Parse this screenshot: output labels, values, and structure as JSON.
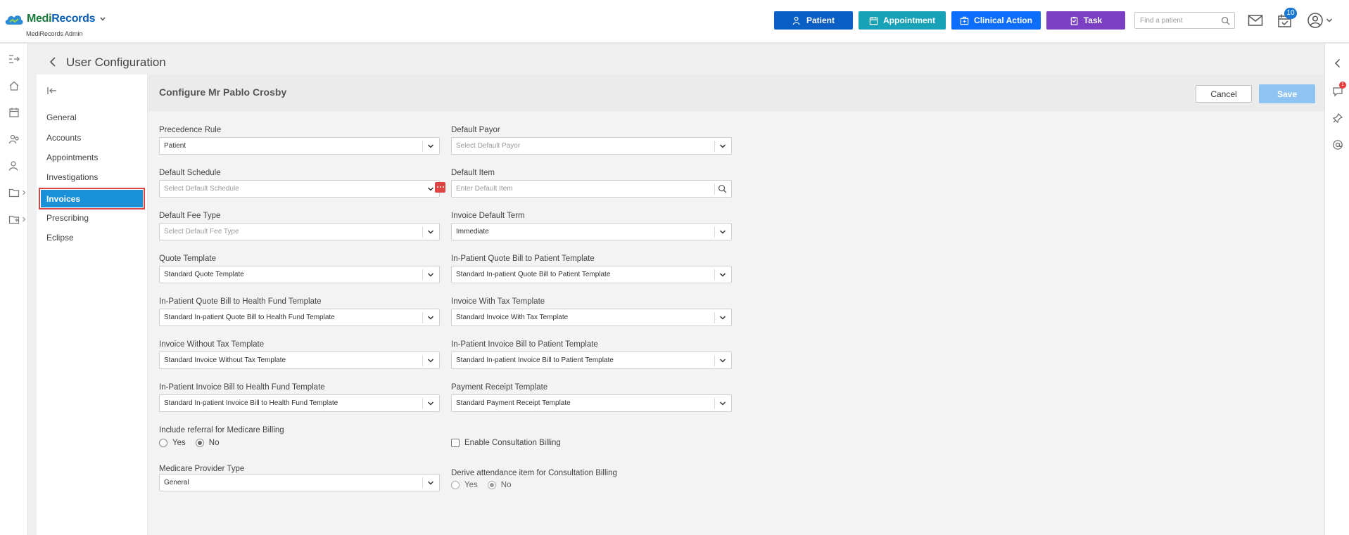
{
  "app": {
    "logo_text_a": "Medi",
    "logo_text_b": "Records",
    "subtitle": "MediRecords Admin"
  },
  "header": {
    "patient_label": "Patient",
    "appointment_label": "Appointment",
    "clinical_action_label": "Clinical Action",
    "task_label": "Task",
    "search_placeholder": "Find a patient",
    "tasks_count": "10",
    "colors": {
      "patient": "#0b5fc4",
      "appointment": "#17a2b8",
      "clinical_action": "#0d6efd",
      "task": "#7b3fc4"
    }
  },
  "notifications_count": "1",
  "page": {
    "title": "User Configuration"
  },
  "subnav": {
    "items": [
      "General",
      "Accounts",
      "Appointments",
      "Investigations",
      "Invoices",
      "Prescribing",
      "Eclipse"
    ],
    "active": "Invoices"
  },
  "content": {
    "title": "Configure Mr Pablo Crosby",
    "cancel_label": "Cancel",
    "save_label": "Save",
    "fields": {
      "precedence_rule": {
        "label": "Precedence Rule",
        "value": "Patient"
      },
      "default_payor": {
        "label": "Default Payor",
        "placeholder": "Select Default Payor"
      },
      "default_schedule": {
        "label": "Default Schedule",
        "placeholder": "Select Default Schedule"
      },
      "default_item": {
        "label": "Default Item",
        "placeholder": "Enter Default Item"
      },
      "default_fee_type": {
        "label": "Default Fee Type",
        "placeholder": "Select Default Fee Type"
      },
      "invoice_default_term": {
        "label": "Invoice Default Term",
        "value": "Immediate"
      },
      "quote_template": {
        "label": "Quote Template",
        "value": "Standard Quote Template"
      },
      "inpatient_quote_patient": {
        "label": "In-Patient Quote Bill to Patient Template",
        "value": "Standard In-patient Quote Bill to Patient Template"
      },
      "inpatient_quote_fund": {
        "label": "In-Patient Quote Bill to Health Fund Template",
        "value": "Standard In-patient Quote Bill to Health Fund Template"
      },
      "invoice_with_tax": {
        "label": "Invoice With Tax Template",
        "value": "Standard Invoice With Tax Template"
      },
      "invoice_without_tax": {
        "label": "Invoice Without Tax Template",
        "value": "Standard Invoice Without Tax Template"
      },
      "inpatient_invoice_patient": {
        "label": "In-Patient Invoice Bill to Patient Template",
        "value": "Standard In-patient Invoice Bill to Patient Template"
      },
      "inpatient_invoice_fund": {
        "label": "In-Patient Invoice Bill to Health Fund Template",
        "value": "Standard In-patient Invoice Bill to Health Fund Template"
      },
      "payment_receipt": {
        "label": "Payment Receipt Template",
        "value": "Standard Payment Receipt Template"
      },
      "include_referral": {
        "label": "Include referral for Medicare Billing",
        "yes": "Yes",
        "no": "No",
        "selected": "No"
      },
      "enable_consultation": {
        "label": "Enable Consultation Billing",
        "checked": false
      },
      "medicare_provider_type": {
        "label": "Medicare Provider Type",
        "value": "General"
      },
      "derive_attendance": {
        "label": "Derive attendance item for Consultation Billing",
        "yes": "Yes",
        "no": "No",
        "selected": "No"
      }
    }
  }
}
